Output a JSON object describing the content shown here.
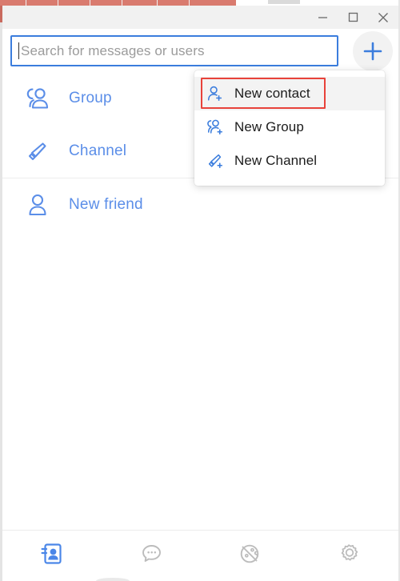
{
  "window": {
    "controls": [
      {
        "name": "minimize",
        "label": "Minimize"
      },
      {
        "name": "maximize",
        "label": "Maximize"
      },
      {
        "name": "close",
        "label": "Close"
      }
    ]
  },
  "search": {
    "placeholder": "Search for messages or users",
    "value": "",
    "focused": true
  },
  "add_button": {
    "icon": "plus-icon",
    "label": "Add"
  },
  "sidebar": {
    "groups": [
      {
        "items": [
          {
            "label": "Group",
            "icon": "group-icon"
          },
          {
            "label": "Channel",
            "icon": "megaphone-icon"
          }
        ]
      },
      {
        "items": [
          {
            "label": "New friend",
            "icon": "person-icon"
          }
        ]
      }
    ]
  },
  "dropdown": {
    "items": [
      {
        "label": "New contact",
        "icon": "person-add-icon",
        "active": true,
        "highlighted": true
      },
      {
        "label": "New Group",
        "icon": "group-add-icon",
        "active": false,
        "highlighted": false
      },
      {
        "label": "New Channel",
        "icon": "megaphone-add-icon",
        "active": false,
        "highlighted": false
      }
    ]
  },
  "bottom_nav": {
    "items": [
      {
        "name": "contacts",
        "icon": "contacts-book-icon",
        "active": true
      },
      {
        "name": "chats",
        "icon": "chat-bubbles-icon",
        "active": false
      },
      {
        "name": "discover",
        "icon": "discover-globe-icon",
        "active": false
      },
      {
        "name": "settings",
        "icon": "gear-icon",
        "active": false
      }
    ]
  },
  "colors": {
    "accent_blue": "#3b7ddd",
    "label_blue": "#5b8ee8",
    "highlight_red": "#e8423a",
    "titlebar_grey": "#f1f1f1",
    "nav_inactive": "#b9b9b9"
  }
}
